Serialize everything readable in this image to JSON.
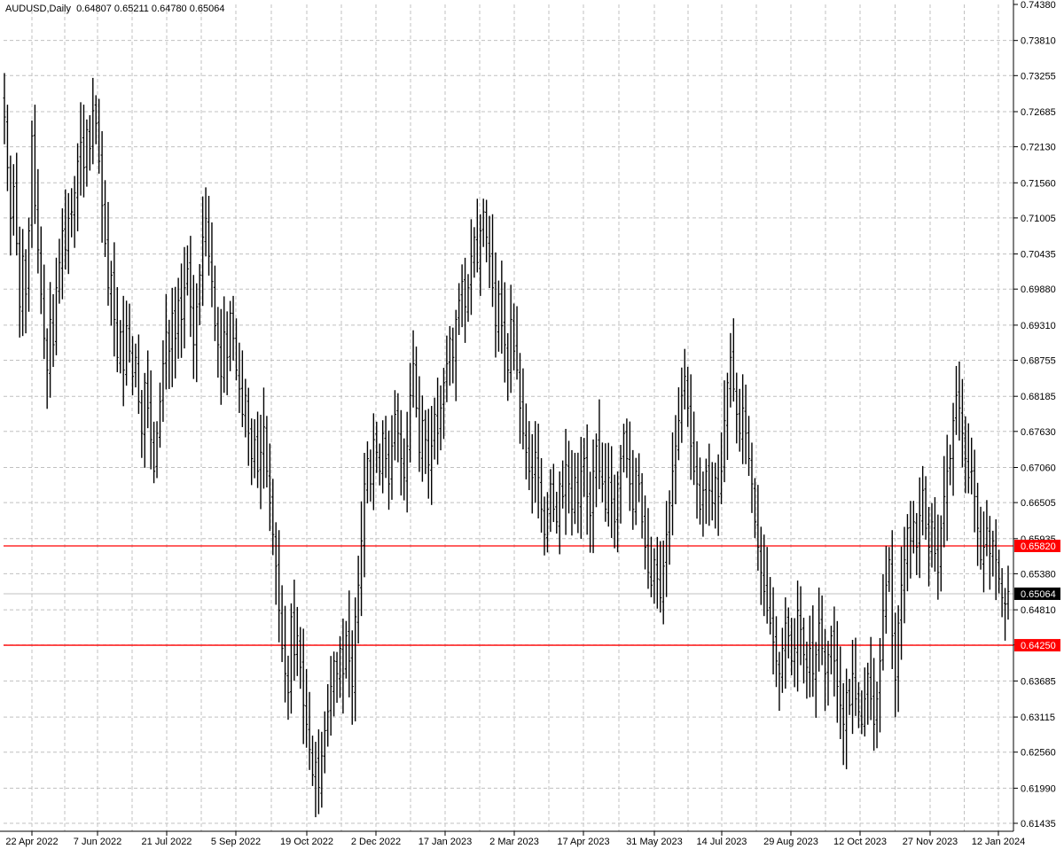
{
  "header": {
    "symbol_timeframe": "AUDUSD,Daily",
    "ohlc": "0.64807 0.65211 0.64780 0.65064"
  },
  "chart_data": {
    "type": "bar",
    "style": "OHLC bars",
    "symbol": "AUDUSD",
    "timeframe": "Daily",
    "ylim": [
      0.61435,
      0.7438
    ],
    "grid": true,
    "price_ticks": [
      "0.74380",
      "0.73810",
      "0.73255",
      "0.72685",
      "0.72130",
      "0.71560",
      "0.71005",
      "0.70435",
      "0.69880",
      "0.69310",
      "0.68755",
      "0.68185",
      "0.67630",
      "0.67060",
      "0.66505",
      "0.65935",
      "0.65380",
      "0.64810",
      "0.64255",
      "0.63685",
      "0.63115",
      "0.62560",
      "0.61990",
      "0.61435"
    ],
    "date_ticks": [
      "22 Apr 2022",
      "7 Jun 2022",
      "21 Jul 2022",
      "5 Sep 2022",
      "19 Oct 2022",
      "2 Dec 2022",
      "17 Jan 2023",
      "2 Mar 2023",
      "17 Apr 2023",
      "31 May 2023",
      "14 Jul 2023",
      "29 Aug 2023",
      "12 Oct 2023",
      "27 Nov 2023",
      "12 Jan 2024"
    ],
    "horizontal_lines": [
      {
        "value": 0.6582,
        "label": "0.65820",
        "color": "#ff0000"
      },
      {
        "value": 0.6425,
        "label": "0.64250",
        "color": "#ff0000"
      }
    ],
    "current_price": {
      "value": 0.65064,
      "label": "0.65064"
    },
    "closes": [
      0.726,
      0.718,
      0.71,
      0.715,
      0.706,
      0.696,
      0.704,
      0.698,
      0.708,
      0.723,
      0.712,
      0.705,
      0.698,
      0.691,
      0.686,
      0.694,
      0.69,
      0.699,
      0.703,
      0.708,
      0.705,
      0.71,
      0.711,
      0.714,
      0.719,
      0.722,
      0.718,
      0.724,
      0.721,
      0.727,
      0.725,
      0.719,
      0.712,
      0.706,
      0.699,
      0.701,
      0.694,
      0.688,
      0.692,
      0.686,
      0.693,
      0.689,
      0.685,
      0.688,
      0.681,
      0.676,
      0.684,
      0.68,
      0.675,
      0.67,
      0.676,
      0.681,
      0.687,
      0.692,
      0.689,
      0.695,
      0.691,
      0.697,
      0.694,
      0.699,
      0.702,
      0.696,
      0.69,
      0.696,
      0.701,
      0.707,
      0.71,
      0.704,
      0.7,
      0.693,
      0.69,
      0.685,
      0.692,
      0.688,
      0.695,
      0.691,
      0.686,
      0.683,
      0.679,
      0.682,
      0.676,
      0.672,
      0.675,
      0.67,
      0.673,
      0.677,
      0.67,
      0.665,
      0.66,
      0.655,
      0.648,
      0.642,
      0.638,
      0.635,
      0.647,
      0.641,
      0.644,
      0.639,
      0.633,
      0.63,
      0.626,
      0.622,
      0.624,
      0.62,
      0.625,
      0.629,
      0.632,
      0.636,
      0.64,
      0.638,
      0.642,
      0.638,
      0.644,
      0.64,
      0.636,
      0.647,
      0.652,
      0.659,
      0.668,
      0.672,
      0.668,
      0.675,
      0.673,
      0.67,
      0.676,
      0.672,
      0.668,
      0.674,
      0.679,
      0.676,
      0.672,
      0.669,
      0.674,
      0.682,
      0.687,
      0.68,
      0.673,
      0.678,
      0.675,
      0.671,
      0.674,
      0.679,
      0.676,
      0.68,
      0.684,
      0.687,
      0.691,
      0.688,
      0.694,
      0.697,
      0.7,
      0.696,
      0.699,
      0.704,
      0.707,
      0.703,
      0.708,
      0.711,
      0.707,
      0.704,
      0.699,
      0.693,
      0.698,
      0.693,
      0.69,
      0.686,
      0.694,
      0.689,
      0.686,
      0.68,
      0.676,
      0.673,
      0.67,
      0.669,
      0.673,
      0.669,
      0.664,
      0.66,
      0.664,
      0.668,
      0.664,
      0.662,
      0.668,
      0.666,
      0.671,
      0.668,
      0.664,
      0.669,
      0.665,
      0.67,
      0.672,
      0.666,
      0.663,
      0.67,
      0.674,
      0.67,
      0.668,
      0.664,
      0.669,
      0.665,
      0.662,
      0.668,
      0.672,
      0.676,
      0.672,
      0.668,
      0.664,
      0.67,
      0.668,
      0.662,
      0.658,
      0.654,
      0.652,
      0.656,
      0.653,
      0.65,
      0.655,
      0.66,
      0.665,
      0.67,
      0.674,
      0.678,
      0.682,
      0.685,
      0.68,
      0.674,
      0.67,
      0.668,
      0.664,
      0.667,
      0.67,
      0.667,
      0.665,
      0.669,
      0.666,
      0.67,
      0.678,
      0.684,
      0.688,
      0.683,
      0.679,
      0.676,
      0.68,
      0.676,
      0.672,
      0.668,
      0.662,
      0.658,
      0.654,
      0.651,
      0.648,
      0.646,
      0.643,
      0.64,
      0.638,
      0.642,
      0.646,
      0.644,
      0.64,
      0.642,
      0.648,
      0.645,
      0.641,
      0.639,
      0.642,
      0.638,
      0.641,
      0.646,
      0.642,
      0.638,
      0.641,
      0.644,
      0.64,
      0.636,
      0.633,
      0.63,
      0.635,
      0.633,
      0.638,
      0.634,
      0.632,
      0.63,
      0.634,
      0.638,
      0.634,
      0.63,
      0.634,
      0.64,
      0.648,
      0.652,
      0.656,
      0.644,
      0.637,
      0.646,
      0.652,
      0.656,
      0.661,
      0.659,
      0.662,
      0.658,
      0.663,
      0.667,
      0.661,
      0.658,
      0.662,
      0.657,
      0.654,
      0.661,
      0.666,
      0.67,
      0.672,
      0.678,
      0.682,
      0.68,
      0.676,
      0.672,
      0.669,
      0.67,
      0.666,
      0.661,
      0.656,
      0.658,
      0.661,
      0.657,
      0.659,
      0.656,
      0.653,
      0.65,
      0.649,
      0.651
    ]
  },
  "colors": {
    "background": "#ffffff",
    "bars": "#000000",
    "grid": "#c0c0c0",
    "level_line": "#ff0000",
    "current_price_bg": "#000000",
    "current_price_line": "#c0c0c0"
  }
}
